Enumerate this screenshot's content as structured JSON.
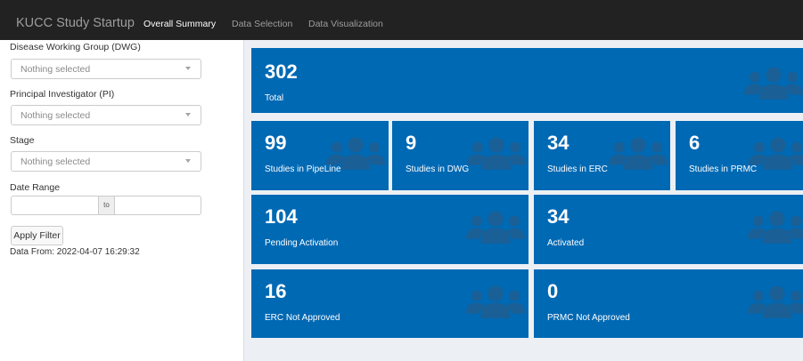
{
  "navbar": {
    "brand": "KUCC Study Startup",
    "tabs": [
      {
        "label": "Overall Summary",
        "active": true
      },
      {
        "label": "Data Selection",
        "active": false
      },
      {
        "label": "Data Visualization",
        "active": false
      }
    ]
  },
  "filters": {
    "dwg": {
      "label": "Disease Working Group (DWG)",
      "value": "Nothing selected"
    },
    "pi": {
      "label": "Principal Investigator (PI)",
      "value": "Nothing selected"
    },
    "stage": {
      "label": "Stage",
      "value": "Nothing selected"
    },
    "date_range": {
      "label": "Date Range",
      "separator": "to",
      "start": "",
      "end": ""
    },
    "apply_label": "Apply Filter",
    "data_from": "Data From: 2022-04-07 16:29:32"
  },
  "cards": {
    "total": {
      "value": "302",
      "label": "Total",
      "icon": "users-icon"
    },
    "pipeline": {
      "value": "99",
      "label": "Studies in PipeLine",
      "icon": "users-icon"
    },
    "dwg": {
      "value": "9",
      "label": "Studies in DWG",
      "icon": "users-icon"
    },
    "erc": {
      "value": "34",
      "label": "Studies in ERC",
      "icon": "users-icon"
    },
    "prmc": {
      "value": "6",
      "label": "Studies in PRMC",
      "icon": "users-icon"
    },
    "pending": {
      "value": "104",
      "label": "Pending Activation",
      "icon": "users-icon"
    },
    "activated": {
      "value": "34",
      "label": "Activated",
      "icon": "users-icon"
    },
    "erc_not_approved": {
      "value": "16",
      "label": "ERC Not Approved",
      "icon": "users-icon"
    },
    "prmc_not_approved": {
      "value": "0",
      "label": "PRMC Not Approved",
      "icon": "users-icon"
    }
  },
  "colors": {
    "navbar": "#222222",
    "card": "#0069b4",
    "icon": "#1a5f95",
    "content_bg": "#ecf0f5"
  }
}
